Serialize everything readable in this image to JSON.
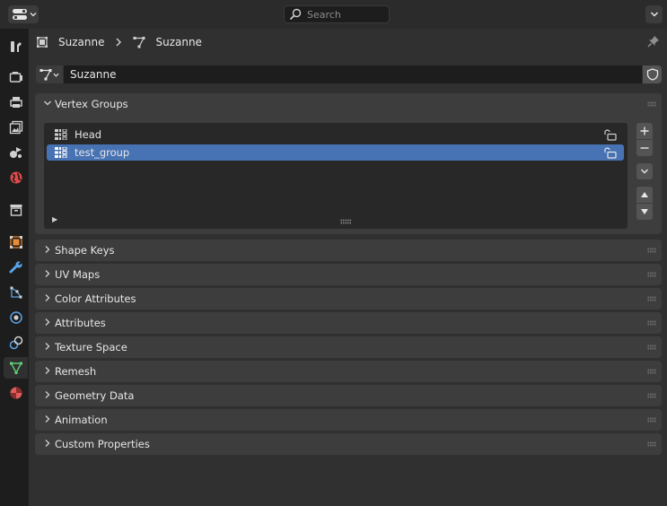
{
  "header": {
    "editor_type_icon": "properties-editor-icon",
    "search": {
      "placeholder": "Search",
      "icon": "search-icon"
    },
    "options_icon": "chevron-down-icon"
  },
  "sidebar_tabs": [
    {
      "name": "tool",
      "icon": "tool-icon",
      "color": "#d0d0d0"
    },
    {
      "name": "render",
      "icon": "render-icon",
      "color": "#d0d0d0"
    },
    {
      "name": "output",
      "icon": "output-icon",
      "color": "#d0d0d0"
    },
    {
      "name": "view-layer",
      "icon": "view-layer-icon",
      "color": "#d0d0d0"
    },
    {
      "name": "scene",
      "icon": "scene-icon",
      "color": "#d0d0d0"
    },
    {
      "name": "world",
      "icon": "world-icon",
      "color": "#e04a4a"
    },
    {
      "name": "collection",
      "icon": "collection-icon",
      "color": "#d0d0d0"
    },
    {
      "name": "object",
      "icon": "object-icon",
      "color": "#e98c38"
    },
    {
      "name": "modifiers",
      "icon": "wrench-icon",
      "color": "#5ba4e8"
    },
    {
      "name": "particles",
      "icon": "particles-icon",
      "color": "#5ba4e8"
    },
    {
      "name": "physics",
      "icon": "physics-icon",
      "color": "#5ba4e8"
    },
    {
      "name": "constraints",
      "icon": "constraints-icon",
      "color": "#5ba4e8"
    },
    {
      "name": "data",
      "icon": "mesh-data-icon",
      "color": "#5fd17a",
      "active": true
    },
    {
      "name": "material",
      "icon": "material-icon",
      "color": "#e05c5c"
    }
  ],
  "breadcrumb": {
    "object": "Suzanne",
    "mesh": "Suzanne"
  },
  "mesh": {
    "name": "Suzanne"
  },
  "vertex_groups": {
    "title": "Vertex Groups",
    "items": [
      {
        "label": "Head",
        "selected": false
      },
      {
        "label": "test_group",
        "selected": true
      }
    ]
  },
  "panels": [
    "Shape Keys",
    "UV Maps",
    "Color Attributes",
    "Attributes",
    "Texture Space",
    "Remesh",
    "Geometry Data",
    "Animation",
    "Custom Properties"
  ],
  "colors": {
    "selection": "#4772b3",
    "panel": "#3d3d3d",
    "background": "#303030",
    "active_tab_icon": "#5fd17a"
  }
}
